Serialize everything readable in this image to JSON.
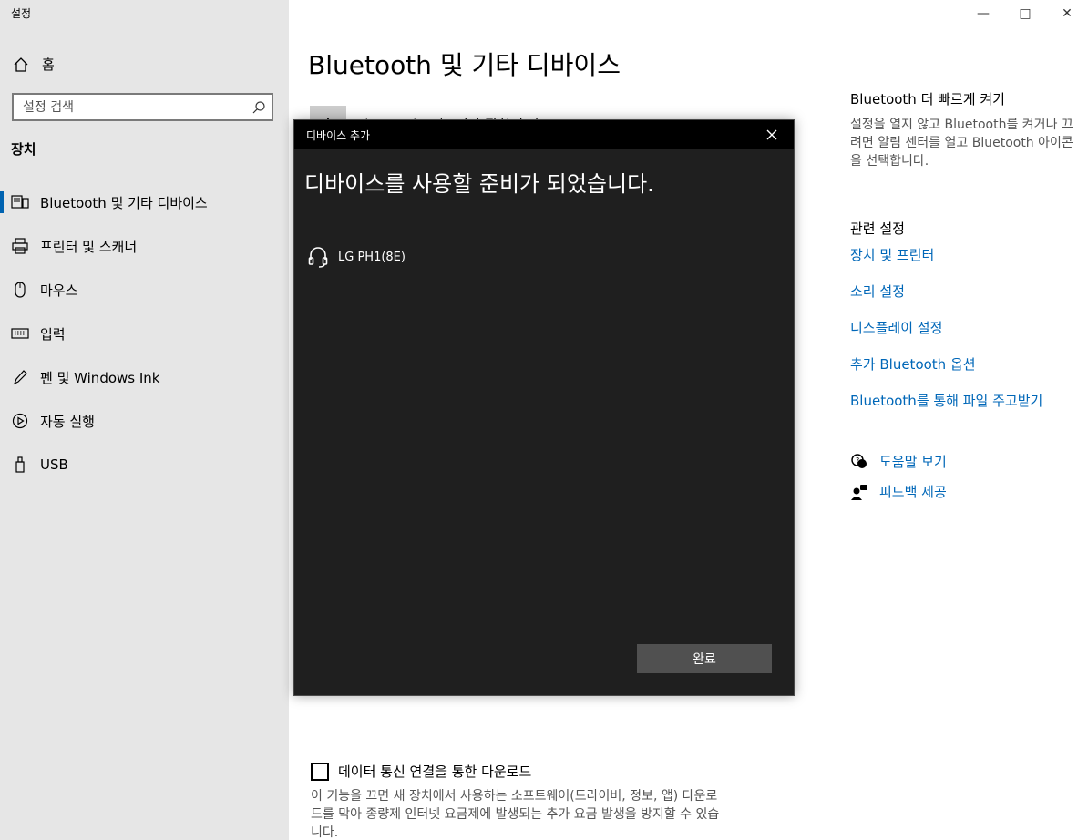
{
  "app": {
    "title": "설정"
  },
  "sidebar": {
    "home_label": "홈",
    "search_placeholder": "설정 검색",
    "section_title": "장치",
    "items": [
      {
        "label": "Bluetooth 및 기타 디바이스",
        "icon": "bluetooth-devices-icon",
        "active": true
      },
      {
        "label": "프린터 및 스캐너",
        "icon": "printer-icon"
      },
      {
        "label": "마우스",
        "icon": "mouse-icon"
      },
      {
        "label": "입력",
        "icon": "keyboard-icon"
      },
      {
        "label": "펜 및 Windows Ink",
        "icon": "pen-icon"
      },
      {
        "label": "자동 실행",
        "icon": "autoplay-icon"
      },
      {
        "label": "USB",
        "icon": "usb-icon"
      }
    ]
  },
  "main": {
    "title": "Bluetooth 및 기타 디바이스",
    "add_device_label": "Bluetooth 또는 기타 장치 추가",
    "metered_checkbox_label": "데이터 통신 연결을 통한 다운로드",
    "metered_note": "이 기능을 끄면 새 장치에서 사용하는 소프트웨어(드라이버, 정보, 앱) 다운로드를 막아 종량제 인터넷 요금제에 발생되는 추가 요금 발생을 방지할 수 있습니다."
  },
  "right": {
    "quick_title": "Bluetooth 더 빠르게 켜기",
    "quick_desc": "설정을 열지 않고 Bluetooth를 켜거나 끄려면 알림 센터를 열고 Bluetooth 아이콘을 선택합니다.",
    "related_title": "관련 설정",
    "related_links": [
      "장치 및 프린터",
      "소리 설정",
      "디스플레이 설정",
      "추가 Bluetooth 옵션",
      "Bluetooth를 통해 파일 주고받기"
    ],
    "help_label": "도움말 보기",
    "feedback_label": "피드백 제공"
  },
  "dialog": {
    "title": "디바이스 추가",
    "heading": "디바이스를 사용할 준비가 되었습니다.",
    "device_name": "LG PH1(8E)",
    "device_icon": "headset-icon",
    "done_label": "완료"
  },
  "colors": {
    "accent": "#0067b8",
    "sidebar_bg": "#e6e6e6",
    "dialog_bg": "#1f1f1f"
  }
}
